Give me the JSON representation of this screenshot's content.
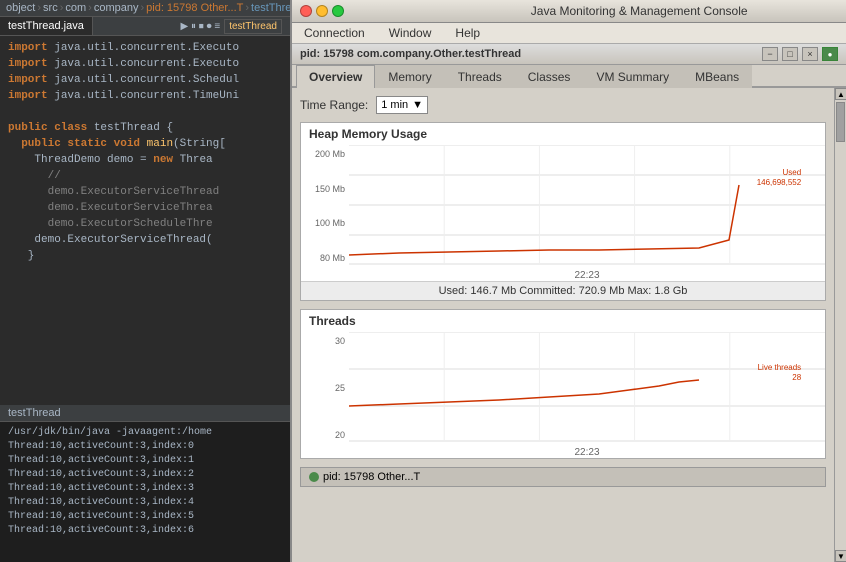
{
  "ide": {
    "breadcrumb": {
      "items": [
        "object",
        "src",
        "com",
        "company",
        "Other",
        "testThread.java"
      ]
    },
    "file_tab": "testThread.java",
    "toolbar_right": "testThread",
    "code_lines": [
      {
        "indent": 0,
        "content": "import java.util.concurrent.Executo"
      },
      {
        "indent": 0,
        "content": "import java.util.concurrent.Executo"
      },
      {
        "indent": 0,
        "content": "import java.util.concurrent.Schedul"
      },
      {
        "indent": 0,
        "content": "import java.util.concurrent.TimeUni"
      },
      {
        "indent": 0,
        "content": ""
      },
      {
        "indent": 0,
        "content": "public class testThread {"
      },
      {
        "indent": 1,
        "content": "  public static void main(String["
      },
      {
        "indent": 2,
        "content": "    ThreadDemo demo = new Threa"
      },
      {
        "indent": 3,
        "content": "      demo.ExecutorServiceThread"
      },
      {
        "indent": 3,
        "content": "      demo.ExecutorServiceThrea"
      },
      {
        "indent": 3,
        "content": "      demo.ExecutorScheduleThre"
      },
      {
        "indent": 2,
        "content": "    demo.ExecutorServiceThread("
      },
      {
        "indent": 0,
        "content": "  }"
      },
      {
        "indent": 0,
        "content": "}"
      }
    ],
    "bottom_label": "testThread",
    "run_output_lines": [
      "/usr/jdk/bin/java -javaagent:/home",
      "Thread:10,activeCount:3,index:0",
      "Thread:10,activeCount:3,index:1",
      "Thread:10,activeCount:3,index:2",
      "Thread:10,activeCount:3,index:3",
      "Thread:10,activeCount:3,index:4",
      "Thread:10,activeCount:3,index:5",
      "Thread:10,activeCount:3,index:6"
    ]
  },
  "jmx": {
    "window_title": "Java Monitoring & Management Console",
    "pid_title": "pid: 15798 com.company.Other.testThread",
    "menu_items": [
      "Connection",
      "Window",
      "Help"
    ],
    "window_btns": {
      "close": "×",
      "min": "−",
      "max": "+"
    },
    "pid_btns": [
      "−",
      "□",
      "×"
    ],
    "tabs": [
      "Overview",
      "Memory",
      "Threads",
      "Classes",
      "VM Summary",
      "MBeans"
    ],
    "active_tab": "Overview",
    "time_range_label": "Time Range:",
    "time_range_value": "1 min",
    "heap_chart": {
      "title": "Heap Memory Usage",
      "y_labels": [
        "200 Mb",
        "150 Mb",
        "100 Mb",
        "80 Mb"
      ],
      "x_label": "22:23",
      "stats": "Used: 146.7 Mb    Committed: 720.9 Mb    Max: 1.8 Gb",
      "legend": "Used\n146,698,552",
      "line_color": "#cc3300"
    },
    "threads_chart": {
      "title": "Threads",
      "y_labels": [
        "30",
        "25",
        "20"
      ],
      "x_label": "22:23",
      "legend": "Live threads\n28",
      "line_color": "#cc3300"
    },
    "bottom_pid": "pid: 15798   Other...T"
  }
}
